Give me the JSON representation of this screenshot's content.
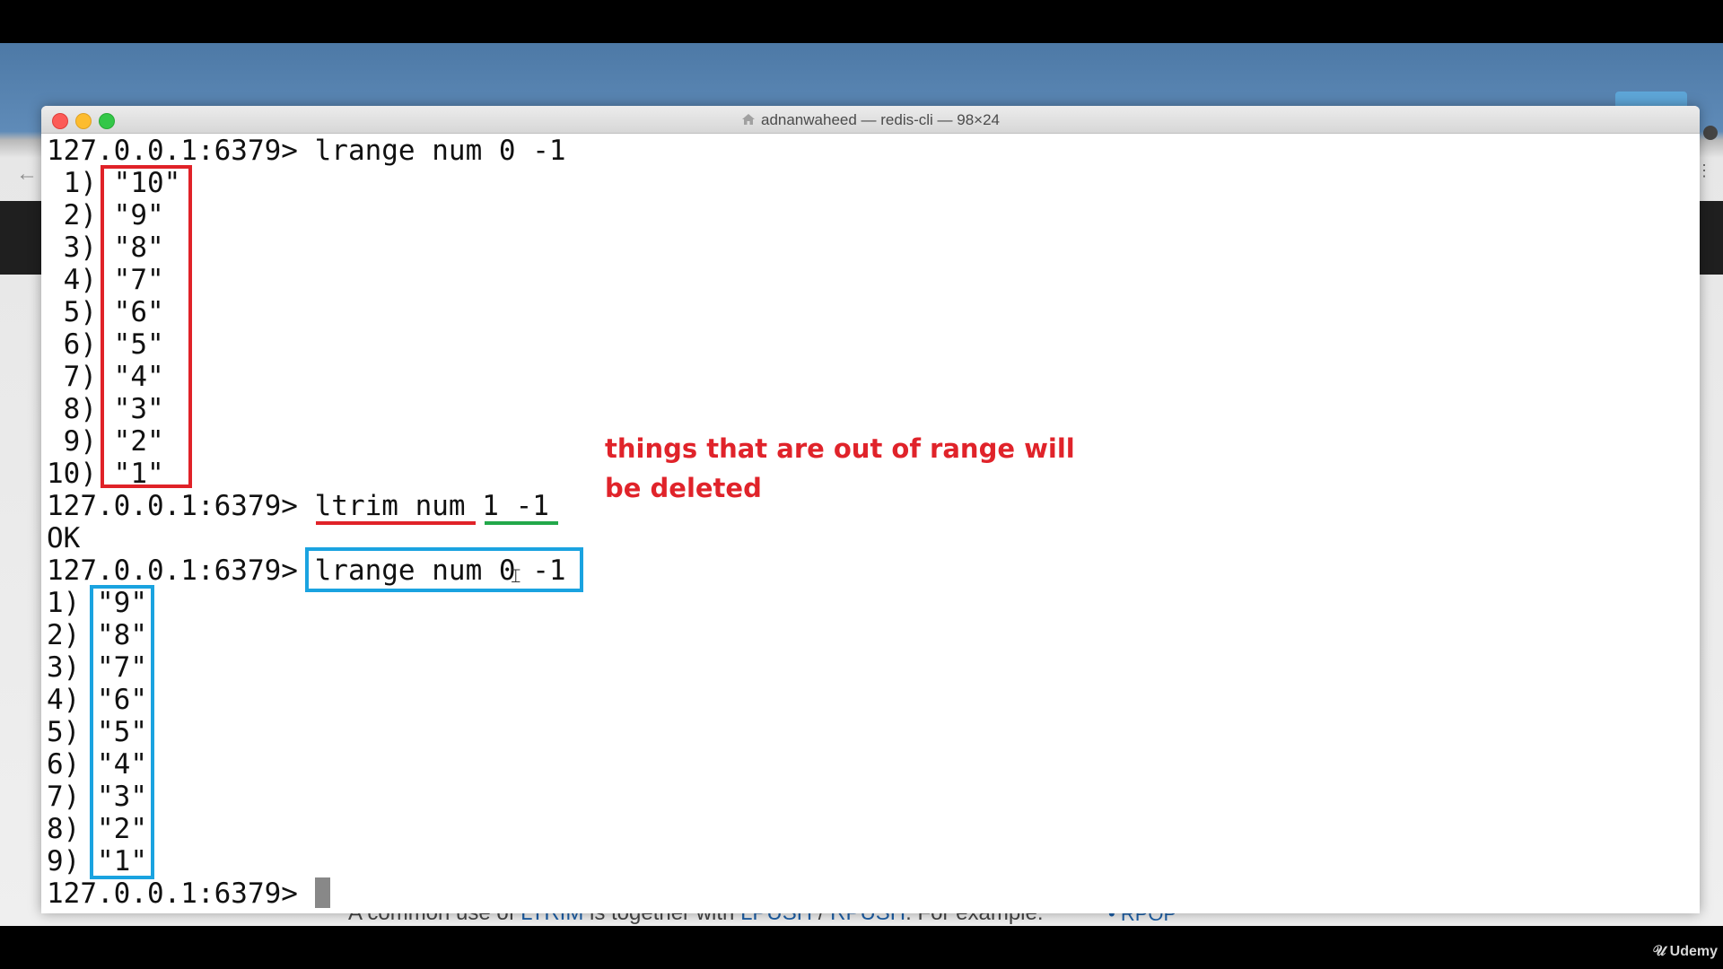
{
  "window": {
    "title": "adnanwaheed — redis-cli — 98×24",
    "home_icon": "home-icon"
  },
  "terminal": {
    "lines": [
      "127.0.0.1:6379> lrange num 0 -1",
      " 1) \"10\"",
      " 2) \"9\"",
      " 3) \"8\"",
      " 4) \"7\"",
      " 5) \"6\"",
      " 6) \"5\"",
      " 7) \"4\"",
      " 8) \"3\"",
      " 9) \"2\"",
      "10) \"1\"",
      "127.0.0.1:6379> ltrim num 1 -1",
      "OK",
      "127.0.0.1:6379> lrange num 0 -1",
      "1) \"9\"",
      "2) \"8\"",
      "3) \"7\"",
      "4) \"6\"",
      "5) \"5\"",
      "6) \"4\"",
      "7) \"3\"",
      "8) \"2\"",
      "9) \"1\"",
      "127.0.0.1:6379> "
    ]
  },
  "annotation": {
    "note": "things that are out of range will be deleted",
    "colors": {
      "red": "#e02228",
      "green": "#22a84a",
      "blue": "#1aa3e0"
    }
  },
  "background_page": {
    "text_before": "A common use of ",
    "link1": "LTRIM",
    "text_mid": " is together with ",
    "link2": "LPUSH",
    "sep": " / ",
    "link3": "RPUSH",
    "text_after": ". For example:",
    "right_item": "RPOP"
  },
  "watermark": "Udemy"
}
